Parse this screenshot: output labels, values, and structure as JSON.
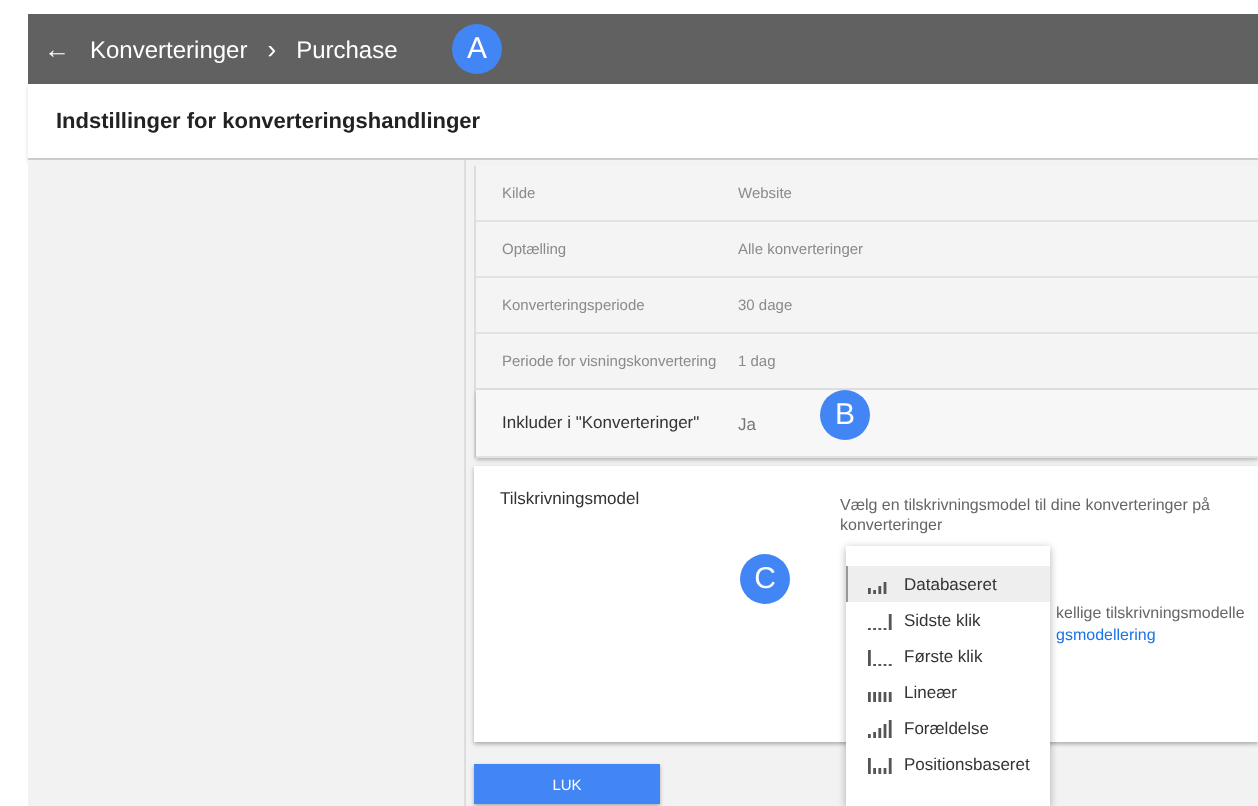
{
  "topbar": {
    "back_icon": "←",
    "breadcrumbs": [
      "Konverteringer",
      "Purchase"
    ],
    "separator": "›"
  },
  "page_title": "Indstillinger for konverteringshandlinger",
  "settings": [
    {
      "label": "Kilde",
      "value": "Website",
      "blurred": true
    },
    {
      "label": "Optælling",
      "value": "Alle konverteringer",
      "blurred": true
    },
    {
      "label": "Konverteringsperiode",
      "value": "30 dage",
      "blurred": true
    },
    {
      "label": "Periode for visningskonvertering",
      "value": "1 dag",
      "blurred": true
    },
    {
      "label": "Inkluder i \"Konverteringer\"",
      "value": "Ja",
      "blurred": false
    }
  ],
  "attribution": {
    "label": "Tilskrivningsmodel",
    "description": [
      "Vælg en tilskrivningsmodel til dine konverteringer på",
      "konverteringer"
    ],
    "partial_text": "kellige tilskrivningsmodelle",
    "partial_link": "gsmodellering"
  },
  "menu": [
    {
      "label": "Databaseret",
      "kind": "data",
      "selected": true
    },
    {
      "label": "Sidste klik",
      "kind": "last",
      "selected": false
    },
    {
      "label": "Første klik",
      "kind": "first",
      "selected": false
    },
    {
      "label": "Lineær",
      "kind": "linear",
      "selected": false
    },
    {
      "label": "Forældelse",
      "kind": "decay",
      "selected": false
    },
    {
      "label": "Positionsbaseret",
      "kind": "position",
      "selected": false
    }
  ],
  "close_button": "LUK",
  "badges": [
    "A",
    "B",
    "C"
  ]
}
